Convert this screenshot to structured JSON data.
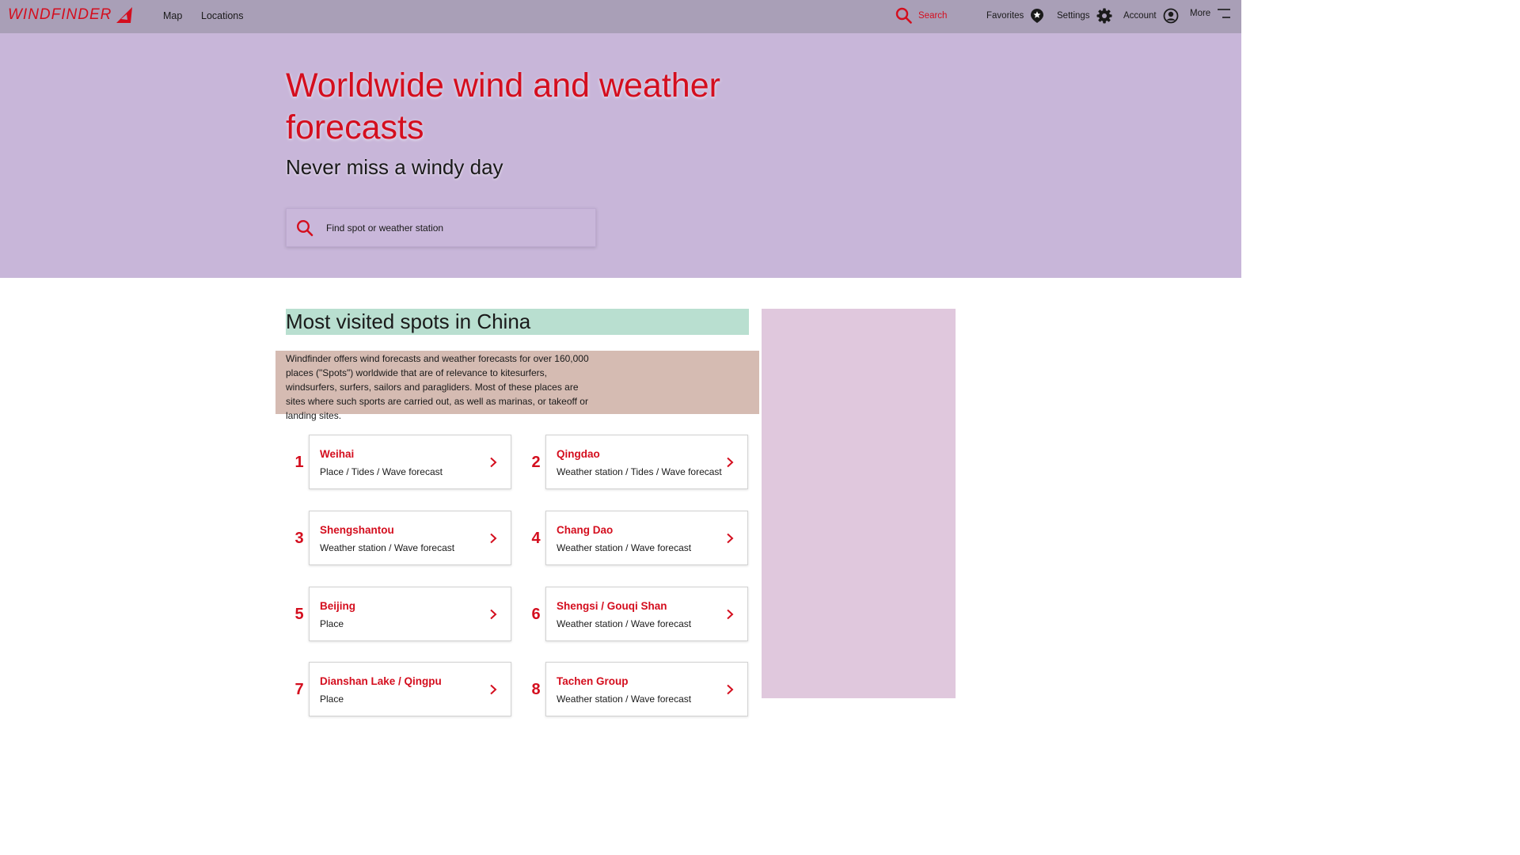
{
  "brand": {
    "logo_text": "WINDFINDER",
    "accent": "#d40e1e"
  },
  "nav": {
    "map": "Map",
    "locations": "Locations",
    "search": "Search",
    "favorites": "Favorites",
    "settings": "Settings",
    "account": "Account",
    "more": "More"
  },
  "hero": {
    "title": "Worldwide wind and weather forecasts",
    "subtitle": "Never miss a windy day",
    "search_placeholder": "Find spot or weather station"
  },
  "main": {
    "section_title": "Most visited spots in China",
    "intro": "Windfinder offers wind forecasts and weather forecasts for over 160,000 places (\"Spots\") worldwide that are of relevance to kitesurfers, windsurfers, surfers, sailors and paragliders. Most of these places are sites where such sports are carried out, as well as marinas, or takeoff or landing sites.",
    "spots": [
      {
        "rank": "1",
        "name": "Weihai",
        "type": "Place / Tides / Wave forecast"
      },
      {
        "rank": "2",
        "name": "Qingdao",
        "type": "Weather station / Tides / Wave forecast"
      },
      {
        "rank": "3",
        "name": "Shengshantou",
        "type": "Weather station / Wave forecast"
      },
      {
        "rank": "4",
        "name": "Chang Dao",
        "type": "Weather station / Wave forecast"
      },
      {
        "rank": "5",
        "name": "Beijing",
        "type": "Place"
      },
      {
        "rank": "6",
        "name": "Shengsi / Gouqi Shan",
        "type": "Weather station / Wave forecast"
      },
      {
        "rank": "7",
        "name": "Dianshan Lake / Qingpu",
        "type": "Place"
      },
      {
        "rank": "8",
        "name": "Tachen Group",
        "type": "Weather station / Wave forecast"
      }
    ]
  }
}
